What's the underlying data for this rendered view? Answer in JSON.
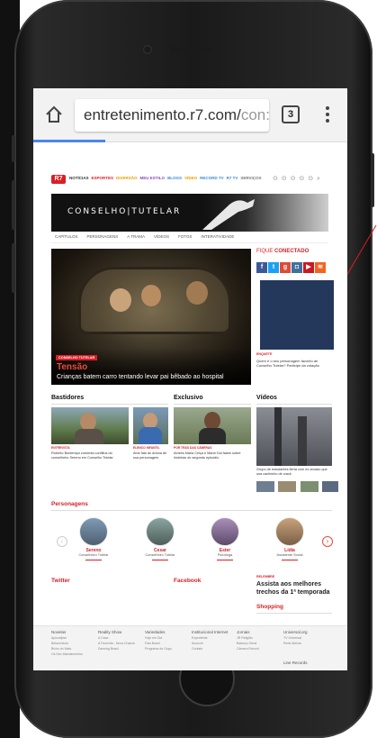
{
  "browser": {
    "url_host": "entretenimento.r7.com/",
    "url_rest": "con:",
    "tab_count": "3"
  },
  "site": {
    "logo": "R7",
    "nav": [
      "NOTÍCIAS",
      "ESPORTES",
      "DIVERSÃO",
      "MEU ESTILO",
      "BLOGS",
      "VÍDEO",
      "RECORD TV",
      "R7 TV",
      "SERVIÇOS"
    ],
    "nav_colors": [
      "#333333",
      "#d71f26",
      "#e5a100",
      "#8a4fb0",
      "#3b8ad9",
      "#e5a100",
      "#3b8ad9",
      "#3b8ad9",
      "#777777"
    ],
    "show_title": "CONSELHO|TUTELAR",
    "subnav": [
      "CAPÍTULOS",
      "PERSONAGENS",
      "A TRAMA",
      "VÍDEOS",
      "FOTOS",
      "INTERATIVIDADE"
    ]
  },
  "hero": {
    "badge": "CONSELHO TUTELAR",
    "title": "Tensão",
    "subtitle": "Crianças batem carro tentando levar pai bêbado ao hospital"
  },
  "sidebar": {
    "heading_1": "FIQUE",
    "heading_2": "CONECTADO",
    "social": [
      {
        "icon": "facebook-icon",
        "glyph": "f",
        "color": "#3b5998"
      },
      {
        "icon": "twitter-icon",
        "glyph": "t",
        "color": "#1da1f2"
      },
      {
        "icon": "google-plus-icon",
        "glyph": "g",
        "color": "#dd4b39"
      },
      {
        "icon": "instagram-icon",
        "glyph": "◘",
        "color": "#3f729b"
      },
      {
        "icon": "youtube-icon",
        "glyph": "▶",
        "color": "#cc181e"
      },
      {
        "icon": "rss-icon",
        "glyph": "≋",
        "color": "#f26522"
      }
    ],
    "tag": "ENQUETE",
    "text": "Quem é o seu personagem favorito de Conselho Tutelar? Participe da votação"
  },
  "sections": {
    "bastidores": {
      "title": "Bastidores",
      "items": [
        {
          "tag": "ENTREVISTA",
          "text": "Roberto Bontempo comenta conflitos do conselheiro Sereno em Conselho Tutelar"
        },
        {
          "tag": "ELENCO INFANTIL",
          "text": "Atriz fala do drama de sua personagem"
        }
      ]
    },
    "exclusivo": {
      "title": "Exclusivo",
      "items": [
        {
          "tag": "POR TRÁS DAS CÂMERAS",
          "text": "Atrizes Maria Ceiça e Maria Gal falam sobre histórias do segundo episódio"
        }
      ]
    },
    "videos": {
      "title": "Vídeos",
      "items": [
        {
          "text": "Grupo de estudantes flerta com ex-viciado que usa cachimbo de crack"
        }
      ]
    }
  },
  "personagens": {
    "title": "Personagens",
    "people": [
      {
        "name": "Sereno",
        "role": "Conselheiro Tutelar"
      },
      {
        "name": "Cesar",
        "role": "Conselheiro Tutelar"
      },
      {
        "name": "Ester",
        "role": "Psicóloga"
      },
      {
        "name": "Lídia",
        "role": "Assistente Social"
      }
    ],
    "prev": "‹",
    "next": "›"
  },
  "social_section": {
    "twitter": "Twitter",
    "facebook": "Facebook",
    "tag": "RELEMBRE",
    "highlight": "Assista aos melhores trechos da 1ª temporada",
    "shopping": "Shopping"
  },
  "footer": {
    "columns": [
      {
        "title": "Novelas",
        "items": [
          "Apocalipse",
          "Belaventura",
          "Bicho do Mato",
          "Os Dez Mandamentos"
        ]
      },
      {
        "title": "Reality Show",
        "items": [
          "A Casa",
          "A Fazenda - Nova Chance",
          "Dancing Brasil"
        ]
      },
      {
        "title": "Variedades",
        "items": [
          "Hoje em Dia",
          "Fala Brasil",
          "Programa do Gugu"
        ]
      },
      {
        "title": "Institucional Internet",
        "items": [
          "Expediente",
          "Anuncie",
          "Contato"
        ]
      },
      {
        "title": "Jornais",
        "items": [
          "JR Religião",
          "Balanço Geral",
          "Câmera Record"
        ]
      },
      {
        "title": "Universal.org",
        "items": [
          "TV Universal",
          "Rede Aleluia"
        ]
      }
    ],
    "extra": "Line Records"
  },
  "colors": {
    "accent": "#d71f26",
    "ad": "#23385b",
    "progress": "#4a86e8"
  }
}
